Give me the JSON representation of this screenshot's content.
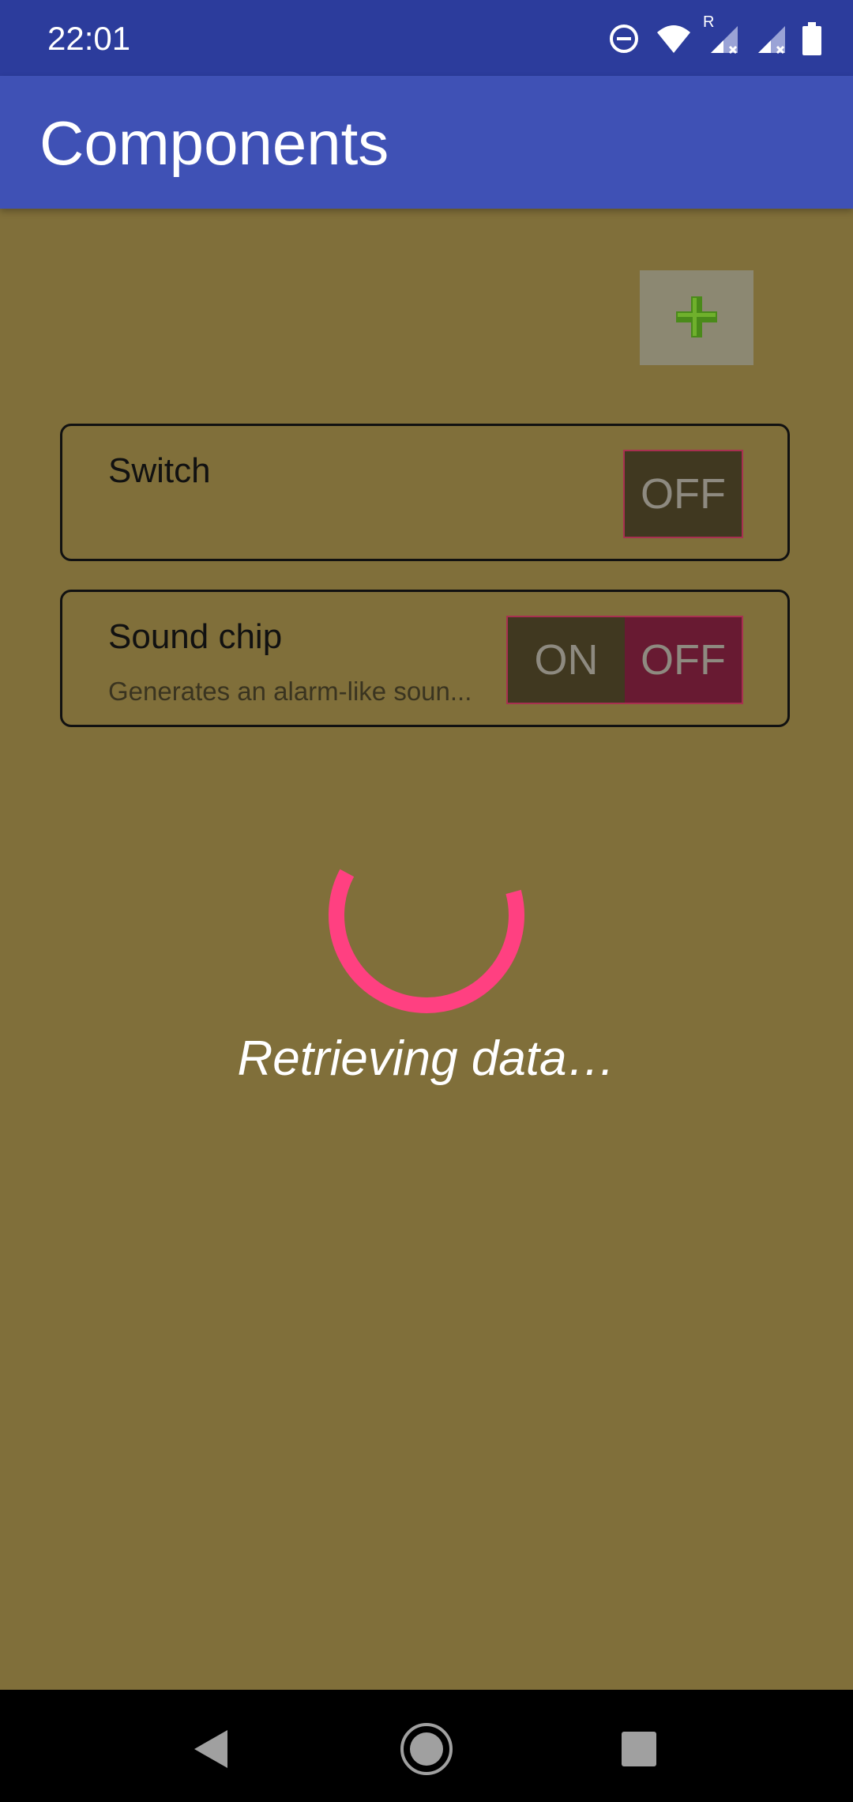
{
  "status_bar": {
    "time": "22:01",
    "icons": [
      "do-not-disturb-icon",
      "wifi-icon",
      "signal-roaming-icon",
      "signal-no-service-icon",
      "battery-icon"
    ],
    "roaming_label": "R"
  },
  "app_bar": {
    "title": "Components",
    "color": "#3f51b5"
  },
  "add_button": {
    "icon": "plus-icon",
    "color": "#4a8a1a"
  },
  "components": [
    {
      "title": "Switch",
      "description": "",
      "toggle": {
        "segments": [
          "OFF"
        ]
      }
    },
    {
      "title": "Sound chip",
      "description": "Generates an alarm-like soun...",
      "toggle": {
        "segments": [
          "ON",
          "OFF"
        ]
      }
    }
  ],
  "loading": {
    "text": "Retrieving data…",
    "spinner_color": "#ff4081"
  },
  "nav_bar": {
    "icons": [
      "back-icon",
      "home-icon",
      "recents-icon"
    ]
  }
}
